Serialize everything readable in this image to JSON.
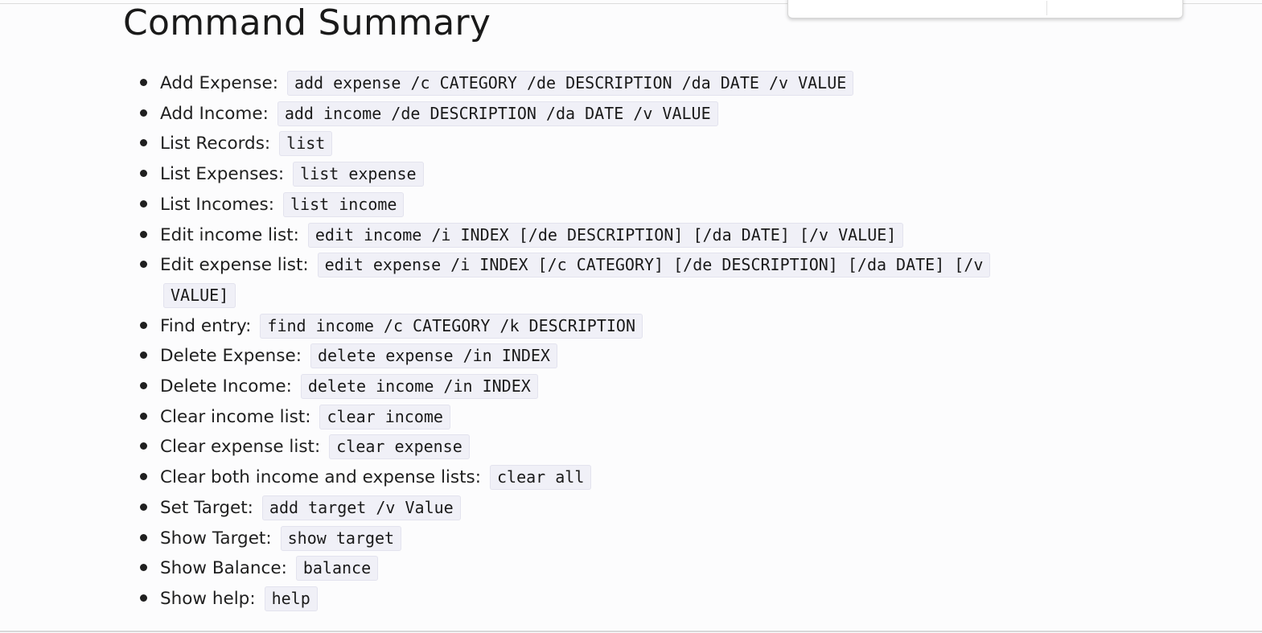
{
  "page": {
    "title": "Command Summary"
  },
  "commands": [
    {
      "label": "Add Expense:",
      "command": "add expense /c CATEGORY /de DESCRIPTION /da DATE /v VALUE"
    },
    {
      "label": "Add Income:",
      "command": "add income /de DESCRIPTION /da DATE /v VALUE"
    },
    {
      "label": "List Records:",
      "command": "list"
    },
    {
      "label": "List Expenses:",
      "command": "list expense"
    },
    {
      "label": "List Incomes:",
      "command": "list income"
    },
    {
      "label": "Edit income list:",
      "command": "edit income /i INDEX [/de DESCRIPTION] [/da DATE] [/v VALUE]"
    },
    {
      "label": "Edit expense list:",
      "command": "edit expense /i INDEX [/c CATEGORY] [/de DESCRIPTION] [/da DATE] [/v VALUE]"
    },
    {
      "label": "Find entry:",
      "command": "find income /c CATEGORY /k DESCRIPTION"
    },
    {
      "label": "Delete Expense:",
      "command": "delete expense /in INDEX"
    },
    {
      "label": "Delete Income:",
      "command": "delete income /in INDEX"
    },
    {
      "label": "Clear income list:",
      "command": "clear income"
    },
    {
      "label": "Clear expense list:",
      "command": "clear expense"
    },
    {
      "label": "Clear both income and expense lists:",
      "command": "clear all"
    },
    {
      "label": "Set Target:",
      "command": "add target /v Value"
    },
    {
      "label": "Show Target:",
      "command": "show target"
    },
    {
      "label": "Show Balance:",
      "command": "balance"
    },
    {
      "label": "Show help:",
      "command": "help"
    }
  ],
  "colors": {
    "background": "#fcfcfd",
    "text": "#1f1f1f",
    "code_background": "#f0f0f7",
    "code_border": "#e3e3ee"
  }
}
